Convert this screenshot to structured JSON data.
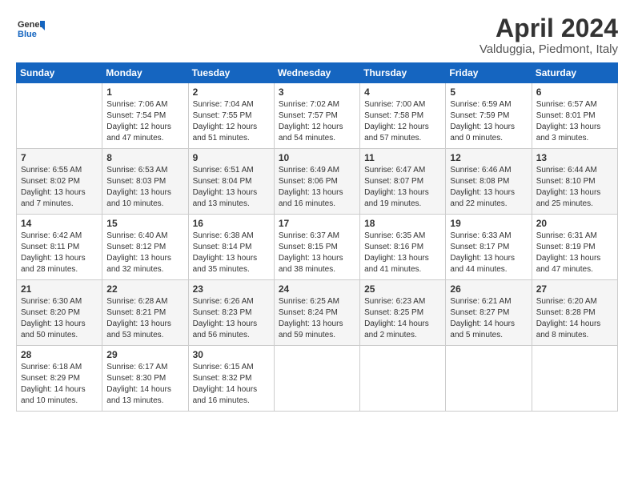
{
  "header": {
    "logo_general": "General",
    "logo_blue": "Blue",
    "month_title": "April 2024",
    "location": "Valduggia, Piedmont, Italy"
  },
  "weekdays": [
    "Sunday",
    "Monday",
    "Tuesday",
    "Wednesday",
    "Thursday",
    "Friday",
    "Saturday"
  ],
  "weeks": [
    [
      {
        "day": "",
        "info": ""
      },
      {
        "day": "1",
        "info": "Sunrise: 7:06 AM\nSunset: 7:54 PM\nDaylight: 12 hours\nand 47 minutes."
      },
      {
        "day": "2",
        "info": "Sunrise: 7:04 AM\nSunset: 7:55 PM\nDaylight: 12 hours\nand 51 minutes."
      },
      {
        "day": "3",
        "info": "Sunrise: 7:02 AM\nSunset: 7:57 PM\nDaylight: 12 hours\nand 54 minutes."
      },
      {
        "day": "4",
        "info": "Sunrise: 7:00 AM\nSunset: 7:58 PM\nDaylight: 12 hours\nand 57 minutes."
      },
      {
        "day": "5",
        "info": "Sunrise: 6:59 AM\nSunset: 7:59 PM\nDaylight: 13 hours\nand 0 minutes."
      },
      {
        "day": "6",
        "info": "Sunrise: 6:57 AM\nSunset: 8:01 PM\nDaylight: 13 hours\nand 3 minutes."
      }
    ],
    [
      {
        "day": "7",
        "info": "Sunrise: 6:55 AM\nSunset: 8:02 PM\nDaylight: 13 hours\nand 7 minutes."
      },
      {
        "day": "8",
        "info": "Sunrise: 6:53 AM\nSunset: 8:03 PM\nDaylight: 13 hours\nand 10 minutes."
      },
      {
        "day": "9",
        "info": "Sunrise: 6:51 AM\nSunset: 8:04 PM\nDaylight: 13 hours\nand 13 minutes."
      },
      {
        "day": "10",
        "info": "Sunrise: 6:49 AM\nSunset: 8:06 PM\nDaylight: 13 hours\nand 16 minutes."
      },
      {
        "day": "11",
        "info": "Sunrise: 6:47 AM\nSunset: 8:07 PM\nDaylight: 13 hours\nand 19 minutes."
      },
      {
        "day": "12",
        "info": "Sunrise: 6:46 AM\nSunset: 8:08 PM\nDaylight: 13 hours\nand 22 minutes."
      },
      {
        "day": "13",
        "info": "Sunrise: 6:44 AM\nSunset: 8:10 PM\nDaylight: 13 hours\nand 25 minutes."
      }
    ],
    [
      {
        "day": "14",
        "info": "Sunrise: 6:42 AM\nSunset: 8:11 PM\nDaylight: 13 hours\nand 28 minutes."
      },
      {
        "day": "15",
        "info": "Sunrise: 6:40 AM\nSunset: 8:12 PM\nDaylight: 13 hours\nand 32 minutes."
      },
      {
        "day": "16",
        "info": "Sunrise: 6:38 AM\nSunset: 8:14 PM\nDaylight: 13 hours\nand 35 minutes."
      },
      {
        "day": "17",
        "info": "Sunrise: 6:37 AM\nSunset: 8:15 PM\nDaylight: 13 hours\nand 38 minutes."
      },
      {
        "day": "18",
        "info": "Sunrise: 6:35 AM\nSunset: 8:16 PM\nDaylight: 13 hours\nand 41 minutes."
      },
      {
        "day": "19",
        "info": "Sunrise: 6:33 AM\nSunset: 8:17 PM\nDaylight: 13 hours\nand 44 minutes."
      },
      {
        "day": "20",
        "info": "Sunrise: 6:31 AM\nSunset: 8:19 PM\nDaylight: 13 hours\nand 47 minutes."
      }
    ],
    [
      {
        "day": "21",
        "info": "Sunrise: 6:30 AM\nSunset: 8:20 PM\nDaylight: 13 hours\nand 50 minutes."
      },
      {
        "day": "22",
        "info": "Sunrise: 6:28 AM\nSunset: 8:21 PM\nDaylight: 13 hours\nand 53 minutes."
      },
      {
        "day": "23",
        "info": "Sunrise: 6:26 AM\nSunset: 8:23 PM\nDaylight: 13 hours\nand 56 minutes."
      },
      {
        "day": "24",
        "info": "Sunrise: 6:25 AM\nSunset: 8:24 PM\nDaylight: 13 hours\nand 59 minutes."
      },
      {
        "day": "25",
        "info": "Sunrise: 6:23 AM\nSunset: 8:25 PM\nDaylight: 14 hours\nand 2 minutes."
      },
      {
        "day": "26",
        "info": "Sunrise: 6:21 AM\nSunset: 8:27 PM\nDaylight: 14 hours\nand 5 minutes."
      },
      {
        "day": "27",
        "info": "Sunrise: 6:20 AM\nSunset: 8:28 PM\nDaylight: 14 hours\nand 8 minutes."
      }
    ],
    [
      {
        "day": "28",
        "info": "Sunrise: 6:18 AM\nSunset: 8:29 PM\nDaylight: 14 hours\nand 10 minutes."
      },
      {
        "day": "29",
        "info": "Sunrise: 6:17 AM\nSunset: 8:30 PM\nDaylight: 14 hours\nand 13 minutes."
      },
      {
        "day": "30",
        "info": "Sunrise: 6:15 AM\nSunset: 8:32 PM\nDaylight: 14 hours\nand 16 minutes."
      },
      {
        "day": "",
        "info": ""
      },
      {
        "day": "",
        "info": ""
      },
      {
        "day": "",
        "info": ""
      },
      {
        "day": "",
        "info": ""
      }
    ]
  ]
}
